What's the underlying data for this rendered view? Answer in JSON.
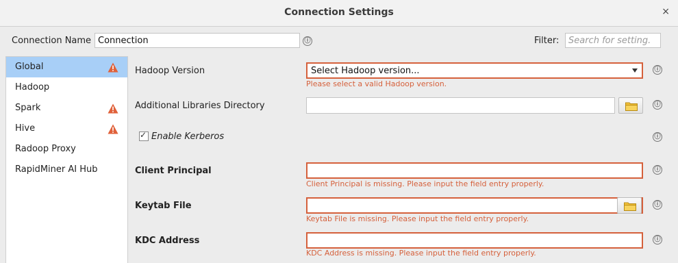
{
  "window": {
    "title": "Connection Settings",
    "close_glyph": "×"
  },
  "topbar": {
    "name_label": "Connection Name",
    "name_value": "Connection",
    "filter_label": "Filter:",
    "filter_placeholder": "Search for setting."
  },
  "icons": {
    "info": "ⓘ",
    "warning_color": "#e0613a",
    "folder_color": "#f5c33b"
  },
  "sidebar": {
    "items": [
      {
        "label": "Global",
        "selected": true,
        "warning": true
      },
      {
        "label": "Hadoop",
        "selected": false,
        "warning": false
      },
      {
        "label": "Spark",
        "selected": false,
        "warning": true
      },
      {
        "label": "Hive",
        "selected": false,
        "warning": true
      },
      {
        "label": "Radoop Proxy",
        "selected": false,
        "warning": false
      },
      {
        "label": "RapidMiner AI Hub",
        "selected": false,
        "warning": false
      }
    ]
  },
  "form": {
    "hadoop_version": {
      "label": "Hadoop Version",
      "value": "Select Hadoop version...",
      "error": "Please select a valid Hadoop version."
    },
    "additional_libraries": {
      "label": "Additional Libraries Directory",
      "value": ""
    },
    "enable_kerberos": {
      "label": "Enable Kerberos",
      "checked": true,
      "check_glyph": "✓"
    },
    "client_principal": {
      "label": "Client Principal",
      "value": "",
      "error": "Client Principal is missing. Please input the field entry properly."
    },
    "keytab_file": {
      "label": "Keytab File",
      "value": "",
      "error": "Keytab File is missing. Please input the field entry properly."
    },
    "kdc_address": {
      "label": "KDC Address",
      "value": "",
      "error": "KDC Address is missing. Please input the field entry properly."
    }
  },
  "colors": {
    "error": "#d5603b",
    "selection": "#a8cff7"
  }
}
